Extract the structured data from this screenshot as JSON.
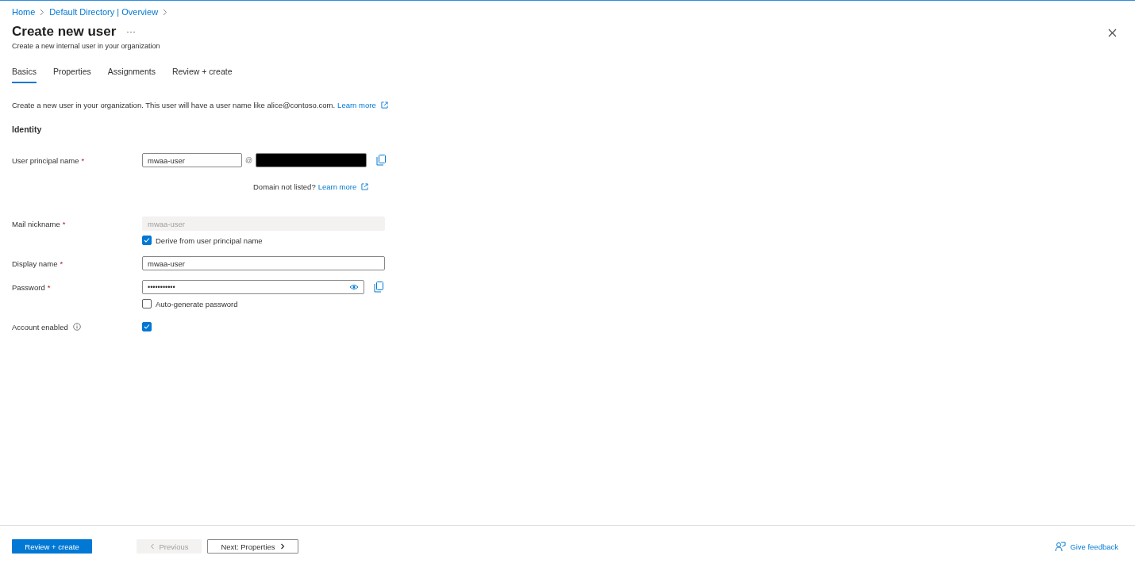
{
  "breadcrumb": [
    "Home",
    "Default Directory | Overview"
  ],
  "title": "Create new user",
  "subtitle": "Create a new internal user in your organization",
  "tabs": [
    {
      "label": "Basics",
      "selected": true
    },
    {
      "label": "Properties",
      "selected": false
    },
    {
      "label": "Assignments",
      "selected": false
    },
    {
      "label": "Review + create",
      "selected": false
    }
  ],
  "intro": {
    "text": "Create a new user in your organization. This user will have a user name like alice@contoso.com.",
    "link": "Learn more"
  },
  "section": "Identity",
  "required_mark": "*",
  "rows": [
    {
      "kind": "upn",
      "label": "User principal name",
      "required": true,
      "value": "mwaa-user",
      "separator": "@"
    },
    {
      "kind": "hint",
      "text": "Domain not listed?",
      "link": "Learn more"
    },
    {
      "kind": "text",
      "label": "Mail nickname",
      "required": true,
      "value": "mwaa-user",
      "disabled": true
    },
    {
      "kind": "checkbox",
      "text": "Derive from user principal name",
      "checked": true
    },
    {
      "kind": "text",
      "label": "Display name",
      "required": true,
      "value": "mwaa-user",
      "disabled": false
    },
    {
      "kind": "password",
      "label": "Password",
      "required": true,
      "value": "•••••••••••"
    },
    {
      "kind": "checkbox",
      "text": "Auto-generate password",
      "checked": false
    },
    {
      "kind": "labeled-check",
      "label": "Account enabled",
      "info": true,
      "checked": true
    }
  ],
  "footer": {
    "primary": "Review + create",
    "previous": {
      "label": "Previous",
      "disabled": true
    },
    "next": {
      "label": "Next: Properties",
      "disabled": false
    },
    "feedback": "Give feedback"
  }
}
